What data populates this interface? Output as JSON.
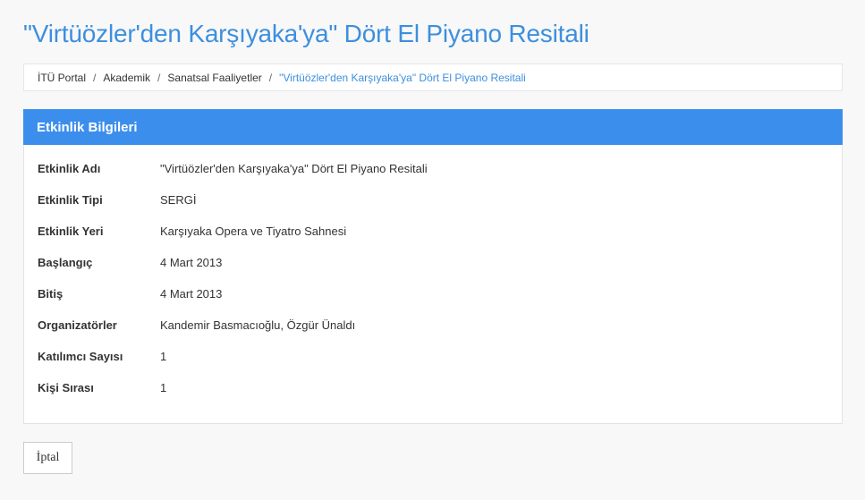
{
  "page": {
    "title": "\"Virtüözler'den Karşıyaka'ya\" Dört El Piyano Resitali"
  },
  "breadcrumb": {
    "items": [
      "İTÜ Portal",
      "Akademik",
      "Sanatsal Faaliyetler"
    ],
    "separator": "/",
    "current": "\"Virtüözler'den Karşıyaka'ya\" Dört El Piyano Resitali"
  },
  "panel": {
    "heading": "Etkinlik Bilgileri",
    "rows": [
      {
        "label": "Etkinlik Adı",
        "value": "\"Virtüözler'den Karşıyaka'ya\" Dört El Piyano Resitali"
      },
      {
        "label": "Etkinlik Tipi",
        "value": "SERGİ"
      },
      {
        "label": "Etkinlik Yeri",
        "value": "Karşıyaka Opera ve Tiyatro Sahnesi"
      },
      {
        "label": "Başlangıç",
        "value": "4 Mart 2013"
      },
      {
        "label": "Bitiş",
        "value": "4 Mart 2013"
      },
      {
        "label": "Organizatörler",
        "value": "Kandemir Basmacıoğlu, Özgür Ünaldı"
      },
      {
        "label": "Katılımcı Sayısı",
        "value": "1"
      },
      {
        "label": "Kişi Sırası",
        "value": "1"
      }
    ]
  },
  "actions": {
    "cancel_label": "İptal"
  },
  "colors": {
    "accent": "#3d8fde",
    "panel_heading_bg": "#3c8eec",
    "page_bg": "#f8f8f8"
  }
}
